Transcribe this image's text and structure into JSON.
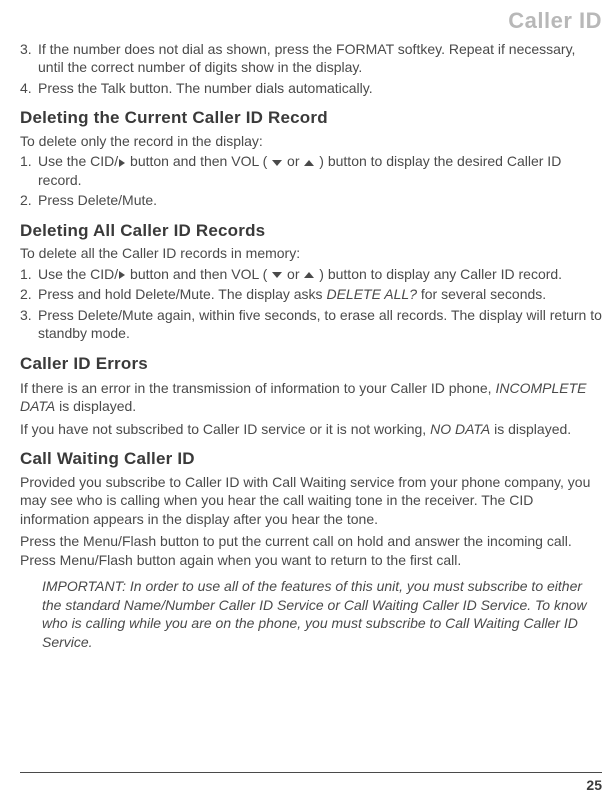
{
  "header": "Caller ID",
  "topList": [
    "If the number does not dial as shown, press the FORMAT softkey. Repeat if necessary, until the correct number of digits show in the display.",
    "Press the Talk button. The number dials automatically."
  ],
  "topListStart": 3,
  "s1": {
    "title": "Deleting the Current Caller ID Record",
    "intro": "To delete only the record in the display:",
    "items": [
      {
        "pre": "Use the CID/",
        "mid": " button and then VOL ( ",
        "post": " ) button to display the desired Caller ID record."
      },
      {
        "plain": "Press Delete/Mute."
      }
    ]
  },
  "s2": {
    "title": "Deleting All Caller ID Records",
    "intro": "To delete all the Caller ID records in memory:",
    "items": [
      {
        "pre": "Use the CID/",
        "mid": " button and then VOL ( ",
        "post": " ) button to display any Caller ID record."
      },
      {
        "plainA": "Press and hold Delete/Mute. The display asks ",
        "em": "DELETE ALL?",
        "plainB": " for several seconds."
      },
      {
        "plain": "Press Delete/Mute again, within five seconds, to erase all records. The display will return to standby mode."
      }
    ]
  },
  "s3": {
    "title": "Caller ID Errors",
    "p1a": "If there is an error in the transmission of information to your Caller ID phone, ",
    "p1em": "INCOMPLETE DATA",
    "p1b": " is displayed.",
    "p2a": "If you have not subscribed to Caller ID service or it is not working, ",
    "p2em": "NO DATA",
    "p2b": " is displayed."
  },
  "s4": {
    "title": "Call Waiting Caller ID",
    "p1": "Provided you subscribe to Caller ID with Call Waiting service from your phone company, you may see who is calling when you hear the call waiting tone in the receiver. The CID information appears in the display after you hear the tone.",
    "p2": "Press the Menu/Flash button to put the current call on hold and answer the incoming call. Press Menu/Flash button again when you want to return to the first call.",
    "note": "IMPORTANT: In order to use all of the features of this unit, you must subscribe to either the standard Name/Number Caller ID Service or Call Waiting Caller ID Service. To know who is calling while you are on the phone, you must subscribe to Call Waiting Caller ID Service."
  },
  "or": " or ",
  "pageNumber": "25"
}
